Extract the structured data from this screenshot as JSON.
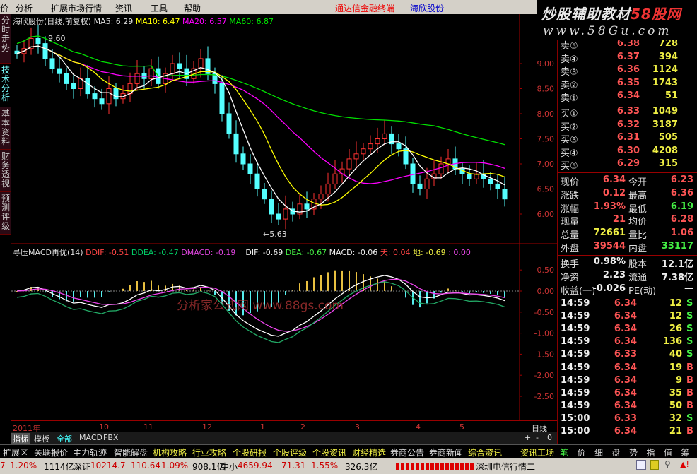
{
  "menu": {
    "items": [
      "价",
      "分析",
      "扩展市场行情",
      "资讯",
      "工具",
      "帮助"
    ],
    "app_title": "通达信金融终端",
    "stock_title": "海欣股份"
  },
  "logo": {
    "line1a": "炒股辅助教材",
    "line1b": "58股网",
    "line2": "www.58Gu.com"
  },
  "side_tabs": [
    "分时走势",
    "技术分析",
    "基本资料",
    "财务透视",
    "预测评级"
  ],
  "main_chart": {
    "title": "海欣股份(日线,前复权)",
    "ma5": "MA5: 6.29",
    "ma10": "MA10: 6.47",
    "ma20": "MA20: 6.57",
    "ma60": "MA60: 6.87",
    "high_label": "9.60",
    "low_label": "←5.63"
  },
  "macd_header": {
    "name": "寻压MACD再优(14)",
    "ddif": "DDIF: -0.51",
    "ddea": "DDEA: -0.47",
    "dmacd": "DMACD: -0.19",
    "dif": "DIF: -0.69",
    "dea": "DEA: -0.67",
    "macd": "MACD: -0.06",
    "tian": "天: 0.04",
    "di": "地: -0.69",
    "extra": ": 0.00"
  },
  "watermark": "分析家公式网 www.88gs.com",
  "colors": {
    "up": "#ff3232",
    "down": "#54ffff",
    "ma5": "#ffffff",
    "ma10": "#ffff00",
    "ma20": "#ff00ff",
    "ma60": "#00e000",
    "axis": "#a00000"
  },
  "chart_data": [
    {
      "type": "candlestick",
      "title": "海欣股份(日线,前复权)",
      "ylim": [
        5.5,
        9.6
      ],
      "yticks": [
        "9.00",
        "8.50",
        "8.00",
        "7.50",
        "7.00",
        "6.50",
        "6.00"
      ],
      "yvals": [
        9.0,
        8.5,
        8.0,
        7.5,
        7.0,
        6.5,
        6.0
      ],
      "closes": [
        9.2,
        9.3,
        9.5,
        9.4,
        9.1,
        8.9,
        8.8,
        8.6,
        8.5,
        8.7,
        8.4,
        8.3,
        8.2,
        8.5,
        8.3,
        8.4,
        8.6,
        8.8,
        8.7,
        8.9,
        8.6,
        8.8,
        9.0,
        8.9,
        8.7,
        8.9,
        9.1,
        8.8,
        8.6,
        8.0,
        7.6,
        7.2,
        7.0,
        6.8,
        6.5,
        6.3,
        6.0,
        5.9,
        6.1,
        6.0,
        6.2,
        6.1,
        6.3,
        6.4,
        6.6,
        6.8,
        6.9,
        7.1,
        7.2,
        7.3,
        7.4,
        7.5,
        7.6,
        7.4,
        7.3,
        7.0,
        6.6,
        6.5,
        6.7,
        6.8,
        7.0,
        7.1,
        6.9,
        6.8,
        6.7,
        6.8,
        6.7,
        6.6,
        6.5,
        6.3
      ],
      "series": [
        "MA5",
        "MA10",
        "MA20",
        "MA60"
      ]
    },
    {
      "type": "bar+line",
      "title": "寻压MACD再优(14)",
      "ylim": [
        -2.7,
        0.75
      ],
      "yticks": [
        "0.50",
        "0.00",
        "-0.50",
        "-1.00",
        "-1.50",
        "-2.00",
        "-2.50"
      ],
      "yvals": [
        0.5,
        0,
        -0.5,
        -1,
        -1.5,
        -2,
        -2.5
      ]
    }
  ],
  "date_axis": [
    "2011年",
    "10",
    "11",
    "12",
    "1",
    "2",
    "3",
    "4",
    "5"
  ],
  "period": "日线",
  "bottom_tabs": [
    "指标",
    "模板",
    "全部",
    "MACD",
    "FBX"
  ],
  "zoom_buttons": [
    "+",
    "-",
    "0"
  ],
  "quote": {
    "sell": [
      {
        "label": "卖⑤",
        "price": "6.38",
        "vol": "728"
      },
      {
        "label": "卖④",
        "price": "6.37",
        "vol": "394"
      },
      {
        "label": "卖③",
        "price": "6.36",
        "vol": "1124"
      },
      {
        "label": "卖②",
        "price": "6.35",
        "vol": "1743"
      },
      {
        "label": "卖①",
        "price": "6.34",
        "vol": "51"
      }
    ],
    "buy": [
      {
        "label": "买①",
        "price": "6.33",
        "vol": "1049"
      },
      {
        "label": "买②",
        "price": "6.32",
        "vol": "3187"
      },
      {
        "label": "买③",
        "price": "6.31",
        "vol": "505"
      },
      {
        "label": "买④",
        "price": "6.30",
        "vol": "4208"
      },
      {
        "label": "买⑤",
        "price": "6.29",
        "vol": "315"
      }
    ],
    "stats": [
      {
        "l1": "现价",
        "v1": "6.34",
        "c1": "red",
        "l2": "今开",
        "v2": "6.23",
        "c2": "red"
      },
      {
        "l1": "涨跌",
        "v1": "0.12",
        "c1": "red",
        "l2": "最高",
        "v2": "6.36",
        "c2": "red"
      },
      {
        "l1": "涨幅",
        "v1": "1.93%",
        "c1": "red",
        "l2": "最低",
        "v2": "6.19",
        "c2": "grn"
      },
      {
        "l1": "现量",
        "v1": "21",
        "c1": "red",
        "l2": "均价",
        "v2": "6.28",
        "c2": "red"
      },
      {
        "l1": "总量",
        "v1": "72661",
        "c1": "yel",
        "l2": "量比",
        "v2": "1.06",
        "c2": "red"
      },
      {
        "l1": "外盘",
        "v1": "39544",
        "c1": "red",
        "l2": "内盘",
        "v2": "33117",
        "c2": "grn"
      }
    ],
    "fund": [
      {
        "l1": "换手",
        "v1": "0.98%",
        "l2": "股本",
        "v2": "12.1亿"
      },
      {
        "l1": "净资",
        "v1": "2.23",
        "l2": "流通",
        "v2": "7.38亿"
      },
      {
        "l1": "收益(一)",
        "v1": "-0.026",
        "l2": "PE(动)",
        "v2": "—"
      }
    ],
    "ticks": [
      {
        "t": "14:59",
        "p": "6.34",
        "v": "12",
        "s": "S"
      },
      {
        "t": "14:59",
        "p": "6.34",
        "v": "12",
        "s": "S"
      },
      {
        "t": "14:59",
        "p": "6.34",
        "v": "26",
        "s": "S"
      },
      {
        "t": "14:59",
        "p": "6.34",
        "v": "136",
        "s": "S"
      },
      {
        "t": "14:59",
        "p": "6.33",
        "v": "40",
        "s": "S"
      },
      {
        "t": "14:59",
        "p": "6.34",
        "v": "19",
        "s": "B"
      },
      {
        "t": "14:59",
        "p": "6.34",
        "v": "9",
        "s": "B"
      },
      {
        "t": "14:59",
        "p": "6.34",
        "v": "35",
        "s": "B"
      },
      {
        "t": "14:59",
        "p": "6.34",
        "v": "50",
        "s": "B"
      },
      {
        "t": "15:00",
        "p": "6.33",
        "v": "32",
        "s": "S"
      },
      {
        "t": "15:00",
        "p": "6.34",
        "v": "21",
        "s": "B"
      }
    ]
  },
  "func_bar": [
    "扩展区",
    "关联报价",
    "主力轨迹",
    "智能解盘",
    "机构攻略",
    "行业攻略",
    "个股研报",
    "个股评级",
    "个股资讯",
    "财经精选",
    "券商公告",
    "券商新闻",
    "综合资讯"
  ],
  "func_right": "资讯工场",
  "right_tabs": [
    "笔",
    "价",
    "细",
    "盘",
    "势",
    "指",
    "值",
    "筹"
  ],
  "status": {
    "a": "7",
    "b": "1.20%",
    "c": "1114亿",
    "sz_name": "深证",
    "sz_val": "10214.7",
    "sz_chg": "110.64",
    "sz_pct": "1.09%",
    "sz_amt": "908.1亿",
    "zx_name": "中小",
    "zx_val": "4659.94",
    "zx_chg": "71.31",
    "zx_pct": "1.55%",
    "zx_amt": "326.3亿",
    "server": "深圳电信行情二"
  }
}
